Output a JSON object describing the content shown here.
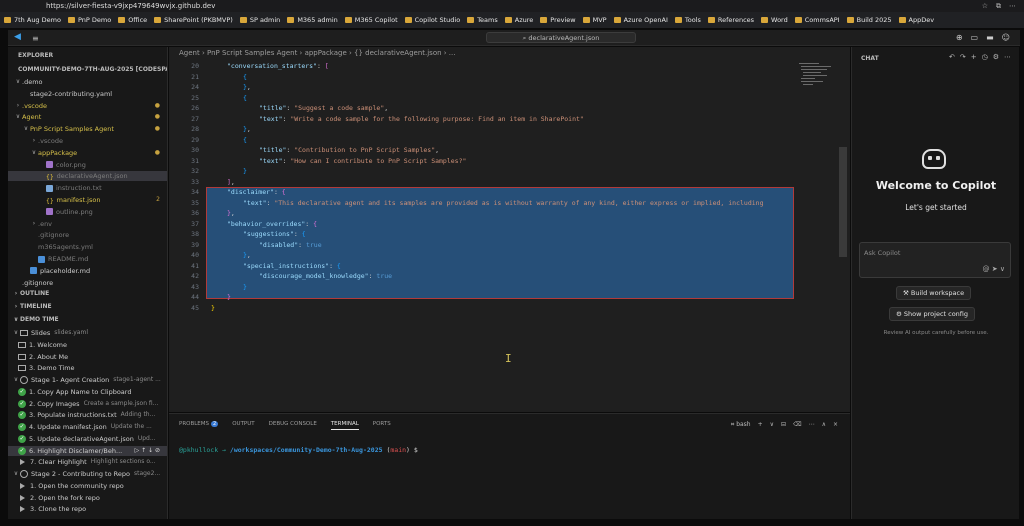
{
  "browser": {
    "url": "https://silver-fiesta-v9jxp479649wvjx.github.dev",
    "bookmarks": [
      "7th Aug Demo",
      "PnP Demo",
      "Office",
      "SharePoint (PKBMVP)",
      "SP admin",
      "M365 admin",
      "M365 Copilot",
      "Copilot Studio",
      "Teams",
      "Azure",
      "Preview",
      "MVP",
      "Azure OpenAI",
      "Tools",
      "References",
      "Word",
      "CommsAPI",
      "Build 2025",
      "AppDev"
    ]
  },
  "command_center": {
    "placeholder": "declarativeAgent.json"
  },
  "explorer": {
    "title": "EXPLORER",
    "workspace": "COMMUNITY-DEMO-7TH-AUG-2025 [CODESPACES: SILVER...",
    "tree": [
      {
        "label": ".demo",
        "fold": "∨",
        "indent": 0,
        "cls": ""
      },
      {
        "label": "stage2-contributing.yaml",
        "fold": "",
        "indent": 1,
        "cls": ""
      },
      {
        "label": ".vscode",
        "fold": ">",
        "indent": 0,
        "cls": "yellow",
        "badge": "●"
      },
      {
        "label": "Agent",
        "fold": "∨",
        "indent": 0,
        "cls": "yellow",
        "badge": "●"
      },
      {
        "label": "PnP Script Samples Agent",
        "fold": "∨",
        "indent": 1,
        "cls": "yellow",
        "badge": "●"
      },
      {
        "label": ".vscode",
        "fold": ">",
        "indent": 2,
        "cls": "gray"
      },
      {
        "label": "appPackage",
        "fold": "∨",
        "indent": 2,
        "cls": "yellow",
        "badge": "●"
      },
      {
        "label": "color.png",
        "fold": "",
        "indent": 3,
        "cls": "gray",
        "icon": "png"
      },
      {
        "label": "declarativeAgent.json",
        "fold": "",
        "indent": 3,
        "cls": "gray",
        "icon": "json",
        "selected": true
      },
      {
        "label": "instruction.txt",
        "fold": "",
        "indent": 3,
        "cls": "gray",
        "icon": "txt"
      },
      {
        "label": "manifest.json",
        "fold": "",
        "indent": 3,
        "cls": "yellow",
        "icon": "json",
        "badge": "2"
      },
      {
        "label": "outline.png",
        "fold": "",
        "indent": 3,
        "cls": "gray",
        "icon": "png"
      },
      {
        "label": ".env",
        "fold": ">",
        "indent": 2,
        "cls": "gray"
      },
      {
        "label": ".gitignore",
        "fold": "",
        "indent": 2,
        "cls": "gray"
      },
      {
        "label": "m365agents.yml",
        "fold": "",
        "indent": 2,
        "cls": "gray"
      },
      {
        "label": "README.md",
        "fold": "",
        "indent": 2,
        "cls": "gray",
        "icon": "md"
      },
      {
        "label": "placeholder.md",
        "fold": "",
        "indent": 1,
        "cls": "",
        "icon": "md"
      },
      {
        "label": ".gitignore",
        "fold": "",
        "indent": 0,
        "cls": ""
      }
    ],
    "outline": "OUTLINE",
    "timeline": "TIMELINE",
    "demo_time": "DEMO TIME",
    "demo_items": [
      {
        "label": "Slides",
        "sub": "slides.yaml",
        "indent": 0,
        "icon": "monitor",
        "fold": "∨"
      },
      {
        "label": "1. Welcome",
        "sub": "",
        "indent": 1,
        "icon": "monitor"
      },
      {
        "label": "2. About Me",
        "sub": "",
        "indent": 1,
        "icon": "monitor"
      },
      {
        "label": "3. Demo Time",
        "sub": "",
        "indent": 1,
        "icon": "monitor"
      },
      {
        "label": "Stage 1- Agent Creation",
        "sub": "stage1-agent ...",
        "indent": 0,
        "icon": "target",
        "fold": "∨"
      },
      {
        "label": "1. Copy App Name to Clipboard",
        "sub": "",
        "indent": 1,
        "icon": "check"
      },
      {
        "label": "2. Copy Images",
        "sub": "Create a sample.json fi...",
        "indent": 1,
        "icon": "check"
      },
      {
        "label": "3. Populate instructions.txt",
        "sub": "Adding th...",
        "indent": 1,
        "icon": "check"
      },
      {
        "label": "4. Update manifest.json",
        "sub": "Update the ...",
        "indent": 1,
        "icon": "check"
      },
      {
        "label": "5. Update declarativeAgent.json",
        "sub": "Upd...",
        "indent": 1,
        "icon": "check"
      },
      {
        "label": "6. Highlight Disclamer/Beh...",
        "sub": "",
        "indent": 1,
        "icon": "check",
        "selected": true,
        "actions": "▷  ↑  ↓  ⊘"
      },
      {
        "label": "7. Clear Highlight",
        "sub": "Highlight sections o...",
        "indent": 1,
        "icon": "play"
      },
      {
        "label": "Stage 2 - Contributing to Repo",
        "sub": "stage2...",
        "indent": 0,
        "icon": "target",
        "fold": "∨"
      },
      {
        "label": "1. Open the community repo",
        "sub": "",
        "indent": 1,
        "icon": "play"
      },
      {
        "label": "2. Open the fork repo",
        "sub": "",
        "indent": 1,
        "icon": "play"
      },
      {
        "label": "3. Clone the repo",
        "sub": "",
        "indent": 1,
        "icon": "play"
      }
    ]
  },
  "editor": {
    "breadcrumb": "Agent › PnP Script Samples Agent › appPackage › {} declarativeAgent.json › ...",
    "lines": [
      {
        "n": "20",
        "html": "<span class='k'>\"conversation_starters\"</span><span class='b'>: </span><span class='br2'>[</span>",
        "indent": 1
      },
      {
        "n": "21",
        "html": "<span class='br3'>{</span>",
        "indent": 2
      },
      {
        "n": "24",
        "html": "<span class='br3'>}</span><span class='b'>,</span>",
        "indent": 2
      },
      {
        "n": "25",
        "html": "<span class='br3'>{</span>",
        "indent": 2
      },
      {
        "n": "26",
        "html": "<span class='k'>\"title\"</span><span class='b'>: </span><span class='s'>\"Suggest a code sample\"</span><span class='b'>,</span>",
        "indent": 3
      },
      {
        "n": "27",
        "html": "<span class='k'>\"text\"</span><span class='b'>: </span><span class='s'>\"Write a code sample for the following purpose: Find an item in SharePoint\"</span>",
        "indent": 3
      },
      {
        "n": "28",
        "html": "<span class='br3'>}</span><span class='b'>,</span>",
        "indent": 2
      },
      {
        "n": "29",
        "html": "<span class='br3'>{</span>",
        "indent": 2
      },
      {
        "n": "30",
        "html": "<span class='k'>\"title\"</span><span class='b'>: </span><span class='s'>\"Contribution to PnP Script Samples\"</span><span class='b'>,</span>",
        "indent": 3
      },
      {
        "n": "31",
        "html": "<span class='k'>\"text\"</span><span class='b'>: </span><span class='s'>\"How can I contribute to PnP Script Samples?\"</span>",
        "indent": 3
      },
      {
        "n": "32",
        "html": "<span class='br3'>}</span>",
        "indent": 2
      },
      {
        "n": "33",
        "html": "<span class='br2'>]</span><span class='b'>,</span>",
        "indent": 1
      },
      {
        "n": "34",
        "html": "<span class='k'>\"disclaimer\"</span><span class='b'>: </span><span class='br2'>{</span>",
        "indent": 1
      },
      {
        "n": "35",
        "html": "<span class='k'>\"text\"</span><span class='b'>: </span><span class='s'>\"This declarative agent and its samples are provided as is without warranty of any kind, either express or implied, including</span>",
        "indent": 2
      },
      {
        "n": "36",
        "html": "<span class='br2'>}</span><span class='b'>,</span>",
        "indent": 1
      },
      {
        "n": "37",
        "html": "<span class='k'>\"behavior_overrides\"</span><span class='b'>: </span><span class='br2'>{</span>",
        "indent": 1
      },
      {
        "n": "38",
        "html": "<span class='k'>\"suggestions\"</span><span class='b'>: </span><span class='br3'>{</span>",
        "indent": 2
      },
      {
        "n": "39",
        "html": "<span class='k'>\"disabled\"</span><span class='b'>: </span><span class='bl'>true</span>",
        "indent": 3
      },
      {
        "n": "40",
        "html": "<span class='br3'>}</span><span class='b'>,</span>",
        "indent": 2
      },
      {
        "n": "41",
        "html": "<span class='k'>\"special_instructions\"</span><span class='b'>: </span><span class='br3'>{</span>",
        "indent": 2
      },
      {
        "n": "42",
        "html": "<span class='k'>\"discourage_model_knowledge\"</span><span class='b'>: </span><span class='bl'>true</span>",
        "indent": 3
      },
      {
        "n": "43",
        "html": "<span class='br3'>}</span>",
        "indent": 2
      },
      {
        "n": "44",
        "html": "<span class='br2'>}</span>",
        "indent": 1
      },
      {
        "n": "45",
        "html": "<span class='br1'>}</span>",
        "indent": 0
      }
    ]
  },
  "panel": {
    "tabs": [
      "PROBLEMS",
      "OUTPUT",
      "DEBUG CONSOLE",
      "TERMINAL",
      "PORTS"
    ],
    "problems_count": "2",
    "active_tab": "TERMINAL",
    "shell": "bash",
    "terminal": {
      "user": "@pkhullock",
      "arrow": "→",
      "path": "/workspaces/Community-Demo-7th-Aug-2025",
      "branch_open": "(",
      "branch": "main",
      "branch_close": ")",
      "prompt": "$"
    }
  },
  "chat": {
    "title": "CHAT",
    "welcome": "Welcome to Copilot",
    "subtitle": "Let's get started",
    "ask_placeholder": "Ask Copilot",
    "build_button": "Build workspace",
    "config_button": "Show project config",
    "review_note": "Review AI output carefully before use."
  },
  "colors": {
    "accent": "#3b9ee8",
    "selection": "#264f78",
    "highlight_border": "#b13a3a",
    "check": "#3fa348"
  }
}
